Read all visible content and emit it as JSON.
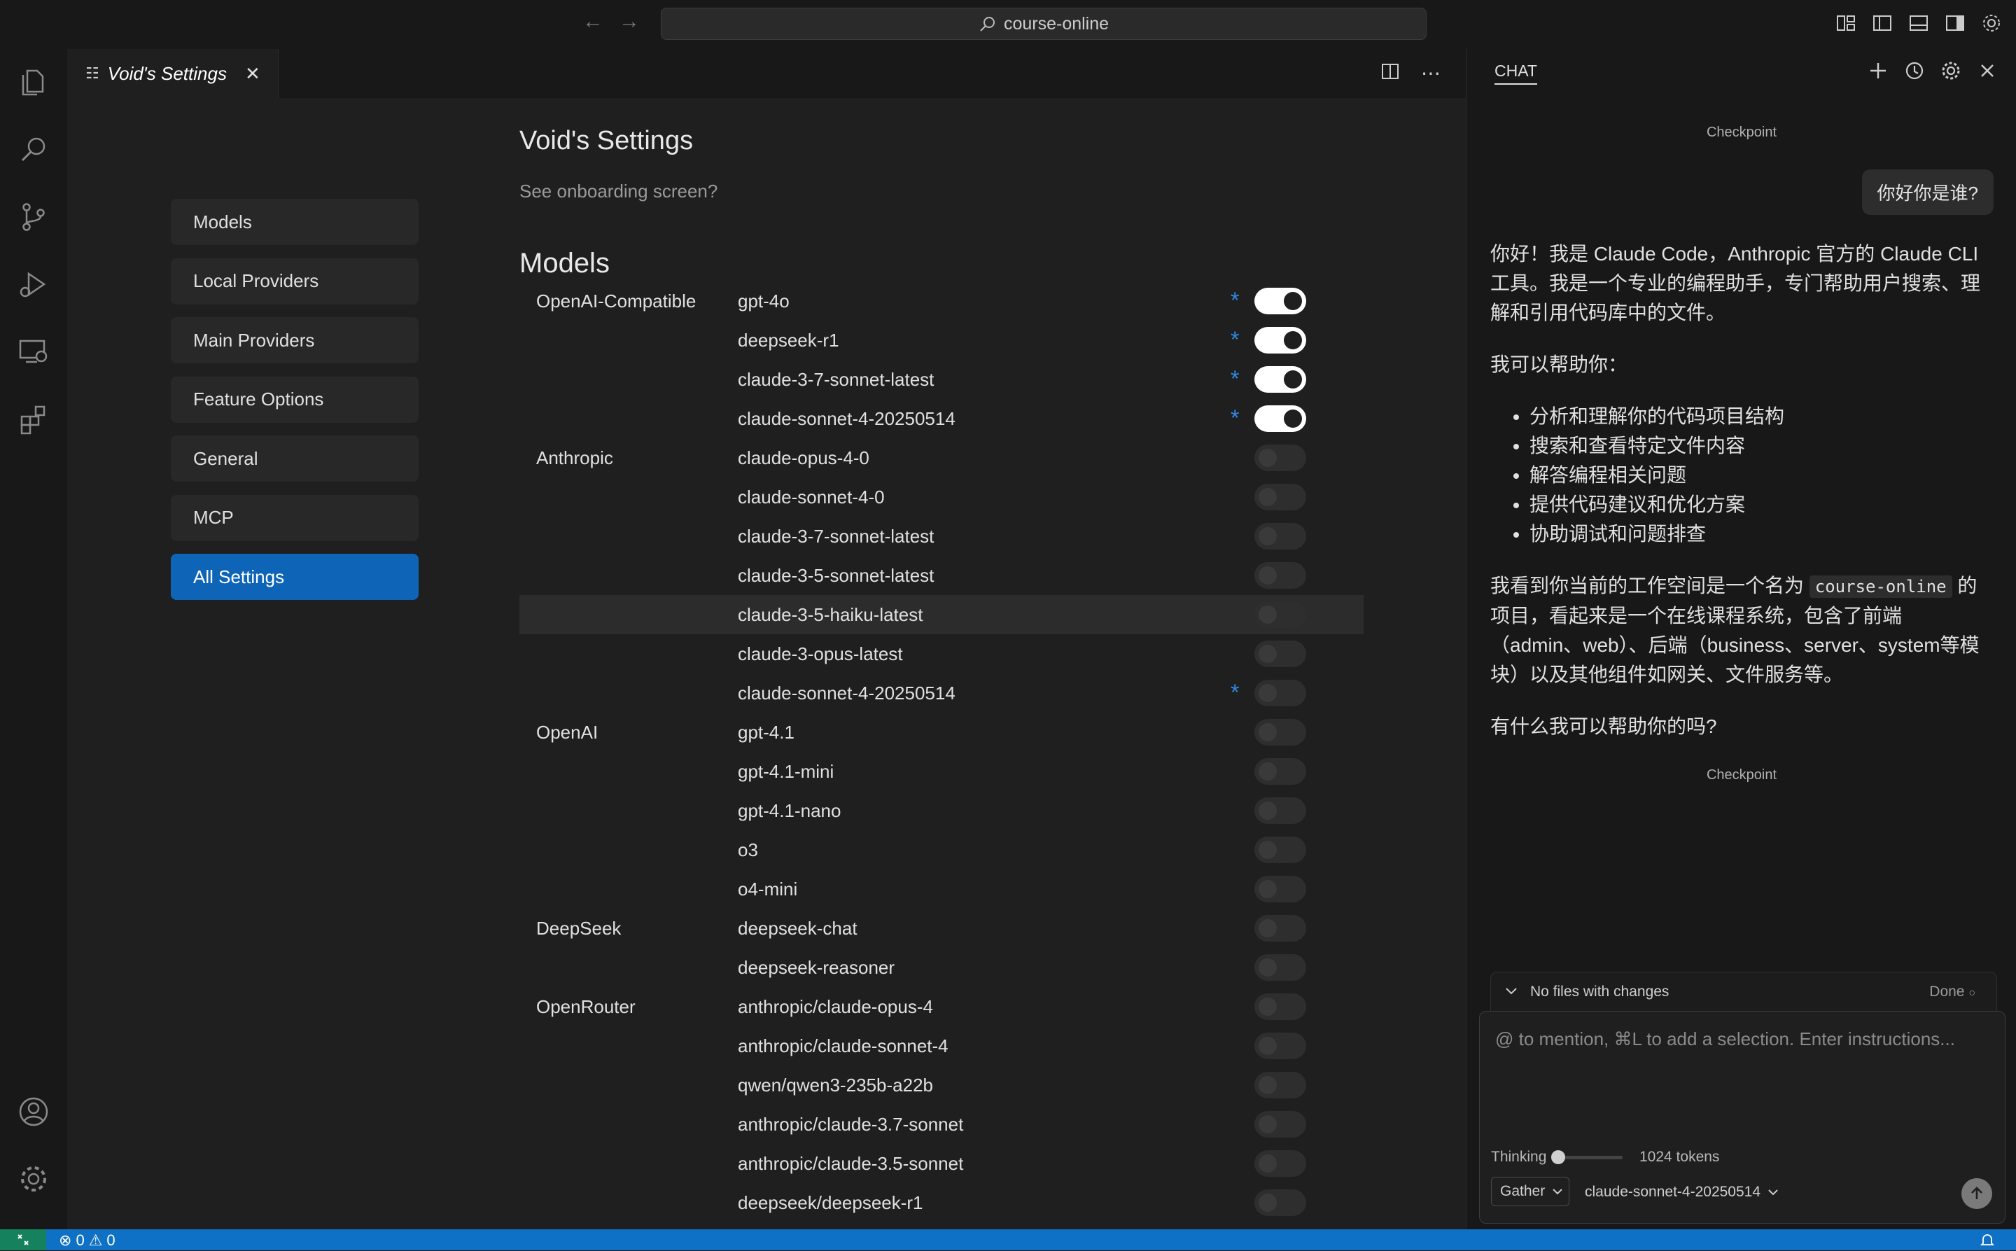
{
  "titlebar": {
    "search": "course-online"
  },
  "tab": {
    "title": "Void's Settings"
  },
  "settings": {
    "title": "Void's Settings",
    "onboarding_link": "See onboarding screen?",
    "nav": [
      {
        "label": "Models",
        "active": false
      },
      {
        "label": "Local Providers",
        "active": false
      },
      {
        "label": "Main Providers",
        "active": false
      },
      {
        "label": "Feature Options",
        "active": false
      },
      {
        "label": "General",
        "active": false
      },
      {
        "label": "MCP",
        "active": false
      },
      {
        "label": "All Settings",
        "active": true
      }
    ],
    "models_heading": "Models",
    "models": [
      {
        "provider": "OpenAI-Compatible",
        "name": "gpt-4o",
        "custom": true,
        "enabled": true
      },
      {
        "provider": "",
        "name": "deepseek-r1",
        "custom": true,
        "enabled": true
      },
      {
        "provider": "",
        "name": "claude-3-7-sonnet-latest",
        "custom": true,
        "enabled": true
      },
      {
        "provider": "",
        "name": "claude-sonnet-4-20250514",
        "custom": true,
        "enabled": true
      },
      {
        "provider": "Anthropic",
        "name": "claude-opus-4-0",
        "custom": false,
        "enabled": false
      },
      {
        "provider": "",
        "name": "claude-sonnet-4-0",
        "custom": false,
        "enabled": false
      },
      {
        "provider": "",
        "name": "claude-3-7-sonnet-latest",
        "custom": false,
        "enabled": false
      },
      {
        "provider": "",
        "name": "claude-3-5-sonnet-latest",
        "custom": false,
        "enabled": false
      },
      {
        "provider": "",
        "name": "claude-3-5-haiku-latest",
        "custom": false,
        "enabled": false,
        "hover": true
      },
      {
        "provider": "",
        "name": "claude-3-opus-latest",
        "custom": false,
        "enabled": false
      },
      {
        "provider": "",
        "name": "claude-sonnet-4-20250514",
        "custom": true,
        "enabled": false
      },
      {
        "provider": "OpenAI",
        "name": "gpt-4.1",
        "custom": false,
        "enabled": false
      },
      {
        "provider": "",
        "name": "gpt-4.1-mini",
        "custom": false,
        "enabled": false
      },
      {
        "provider": "",
        "name": "gpt-4.1-nano",
        "custom": false,
        "enabled": false
      },
      {
        "provider": "",
        "name": "o3",
        "custom": false,
        "enabled": false
      },
      {
        "provider": "",
        "name": "o4-mini",
        "custom": false,
        "enabled": false
      },
      {
        "provider": "DeepSeek",
        "name": "deepseek-chat",
        "custom": false,
        "enabled": false
      },
      {
        "provider": "",
        "name": "deepseek-reasoner",
        "custom": false,
        "enabled": false
      },
      {
        "provider": "OpenRouter",
        "name": "anthropic/claude-opus-4",
        "custom": false,
        "enabled": false
      },
      {
        "provider": "",
        "name": "anthropic/claude-sonnet-4",
        "custom": false,
        "enabled": false
      },
      {
        "provider": "",
        "name": "qwen/qwen3-235b-a22b",
        "custom": false,
        "enabled": false
      },
      {
        "provider": "",
        "name": "anthropic/claude-3.7-sonnet",
        "custom": false,
        "enabled": false
      },
      {
        "provider": "",
        "name": "anthropic/claude-3.5-sonnet",
        "custom": false,
        "enabled": false
      },
      {
        "provider": "",
        "name": "deepseek/deepseek-r1",
        "custom": false,
        "enabled": false
      }
    ],
    "custom_marker": "*"
  },
  "chat": {
    "tab_label": "CHAT",
    "checkpoint": "Checkpoint",
    "user_message": "你好你是谁?",
    "reply": {
      "intro": "你好！我是 Claude Code，Anthropic 官方的 Claude CLI 工具。我是一个专业的编程助手，专门帮助用户搜索、理解和引用代码库中的文件。",
      "can_help": "我可以帮助你：",
      "bullets": [
        "分析和理解你的代码项目结构",
        "搜索和查看特定文件内容",
        "解答编程相关问题",
        "提供代码建议和优化方案",
        "协助调试和问题排查"
      ],
      "workspace_before": "我看到你当前的工作空间是一个名为 ",
      "workspace_code": "course-online",
      "workspace_after": " 的项目，看起来是一个在线课程系统，包含了前端（admin、web）、后端（business、server、system等模块）以及其他组件如网关、文件服务等。",
      "closing": "有什么我可以帮助你的吗?"
    },
    "changes_label": "No files with changes",
    "done_label": "Done",
    "input_placeholder": "@ to mention, ⌘L to add a selection. Enter instructions...",
    "thinking_label": "Thinking",
    "thinking_level": 0,
    "tokens_label": "1024 tokens",
    "mode": "Gather",
    "model": "claude-sonnet-4-20250514"
  },
  "statusbar": {
    "errors": "0",
    "warnings": "0"
  }
}
